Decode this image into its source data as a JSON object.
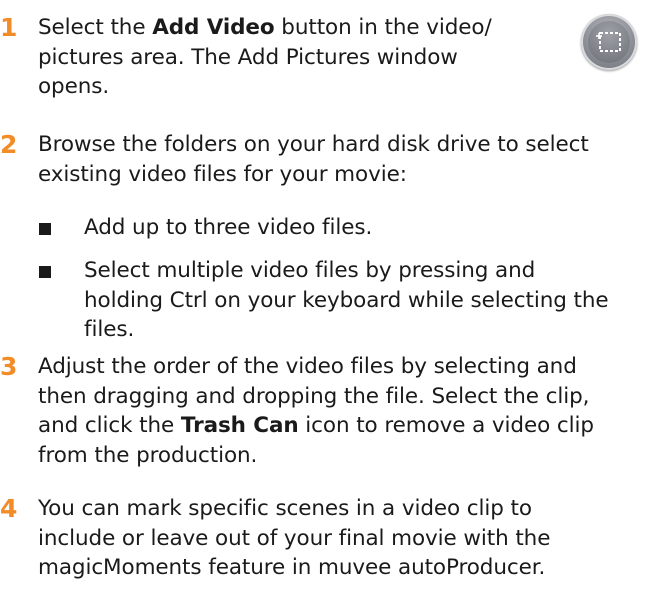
{
  "steps": [
    {
      "number": "1",
      "lines": [
        {
          "before": "Select the ",
          "bold": "Add Video",
          "after": " button in the video/"
        },
        {
          "text": "pictures area. The Add Pictures window"
        },
        {
          "text": "opens."
        }
      ]
    },
    {
      "number": "2",
      "lines": [
        {
          "text": "Browse the folders on your hard disk drive to select"
        },
        {
          "text": "existing video files for your movie:"
        }
      ],
      "bullets": [
        {
          "lines": [
            "Add up to three video files."
          ]
        },
        {
          "lines": [
            "Select multiple video files by pressing and",
            "holding Ctrl on your keyboard while selecting the",
            "files."
          ]
        }
      ]
    },
    {
      "number": "3",
      "lines": [
        {
          "text": "Adjust the order of the video files by selecting and"
        },
        {
          "text": "then dragging and dropping the file. Select the clip,"
        },
        {
          "before": "and click the ",
          "bold": "Trash Can",
          "after": " icon to remove a video clip"
        },
        {
          "text": "from the production."
        }
      ]
    },
    {
      "number": "4",
      "lines": [
        {
          "text": "You can mark specific scenes in a video clip to"
        },
        {
          "text": "include or leave out of your final movie with the"
        },
        {
          "text": "magicMoments feature in muvee autoProducer."
        }
      ]
    }
  ],
  "icons": {
    "add_video": "add-video-icon"
  },
  "colors": {
    "step_number": "#f28c28",
    "text": "#1a1a1a"
  }
}
